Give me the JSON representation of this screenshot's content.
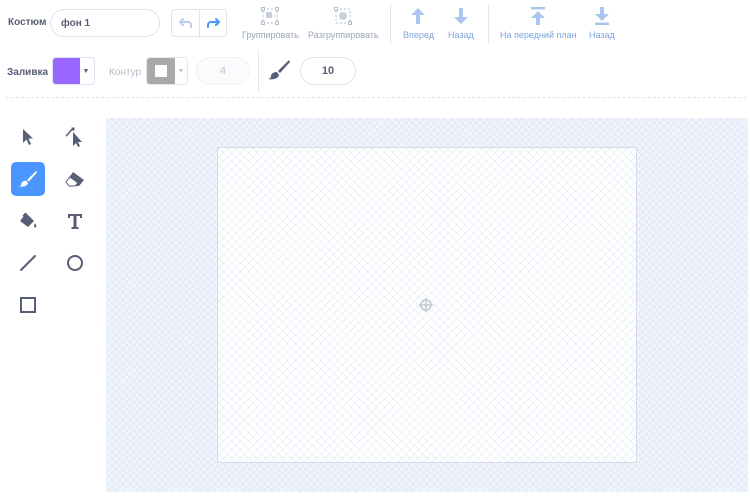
{
  "header": {
    "costume_label": "Костюм",
    "costume_name": "фон 1"
  },
  "toolbar": {
    "undo_icon": "undo-arrow",
    "redo_icon": "redo-arrow",
    "group_label": "Группировать",
    "ungroup_label": "Разгруппировать",
    "forward_label": "Вперед",
    "backward_label": "Назад",
    "front_label": "На передний план",
    "back_label": "Назад"
  },
  "props": {
    "fill_label": "Заливка",
    "fill_color": "#9966ff",
    "outline_label": "Контур",
    "outline_width": "4",
    "brush_size": "10"
  },
  "tools": [
    {
      "name": "select",
      "icon": "arrow-pointer"
    },
    {
      "name": "reshape",
      "icon": "reshape-pointer"
    },
    {
      "name": "brush",
      "icon": "brush",
      "active": true
    },
    {
      "name": "eraser",
      "icon": "eraser"
    },
    {
      "name": "fill",
      "icon": "paint-bucket"
    },
    {
      "name": "text",
      "icon": "text-T"
    },
    {
      "name": "line",
      "icon": "line"
    },
    {
      "name": "circle",
      "icon": "circle"
    },
    {
      "name": "rectangle",
      "icon": "square"
    }
  ],
  "colors": {
    "accent": "#4c97ff",
    "text": "#575e75",
    "disabled": "#9aa5b8"
  }
}
